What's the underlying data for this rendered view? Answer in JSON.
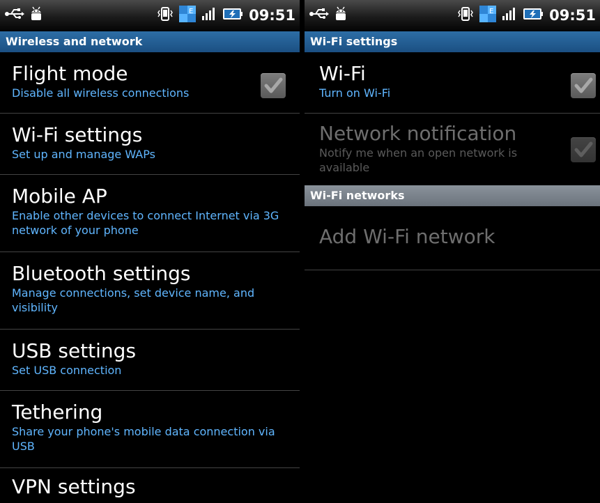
{
  "status_bar": {
    "time": "09:51",
    "icons": [
      "usb-debugging-icon",
      "android-debug-icon",
      "vibrate-icon",
      "sync-icon",
      "signal-icon",
      "battery-charging-icon"
    ]
  },
  "left": {
    "header": "Wireless and network",
    "items": [
      {
        "title": "Flight mode",
        "summary": "Disable all wireless connections",
        "has_checkbox": true,
        "checked": true
      },
      {
        "title": "Wi-Fi settings",
        "summary": "Set up and manage WAPs"
      },
      {
        "title": "Mobile AP",
        "summary": "Enable other devices to connect Internet via 3G network of your phone"
      },
      {
        "title": "Bluetooth settings",
        "summary": "Manage connections, set device name, and visibility"
      },
      {
        "title": "USB settings",
        "summary": "Set USB connection"
      },
      {
        "title": "Tethering",
        "summary": "Share your phone's mobile data connection via USB"
      },
      {
        "title": "VPN settings"
      }
    ]
  },
  "right": {
    "header": "Wi-Fi settings",
    "wifi": {
      "title": "Wi-Fi",
      "summary": "Turn on Wi-Fi",
      "checked": true
    },
    "network_notification": {
      "title": "Network notification",
      "summary": "Notify me when an open network is available",
      "enabled": false,
      "checked": true
    },
    "networks_header": "Wi-Fi networks",
    "add_network": {
      "title": "Add Wi-Fi network",
      "enabled": false
    }
  },
  "colors": {
    "summary_blue": "#60b6ff",
    "header_blue": "#1b4f82",
    "header_grey": "#6b737c"
  }
}
